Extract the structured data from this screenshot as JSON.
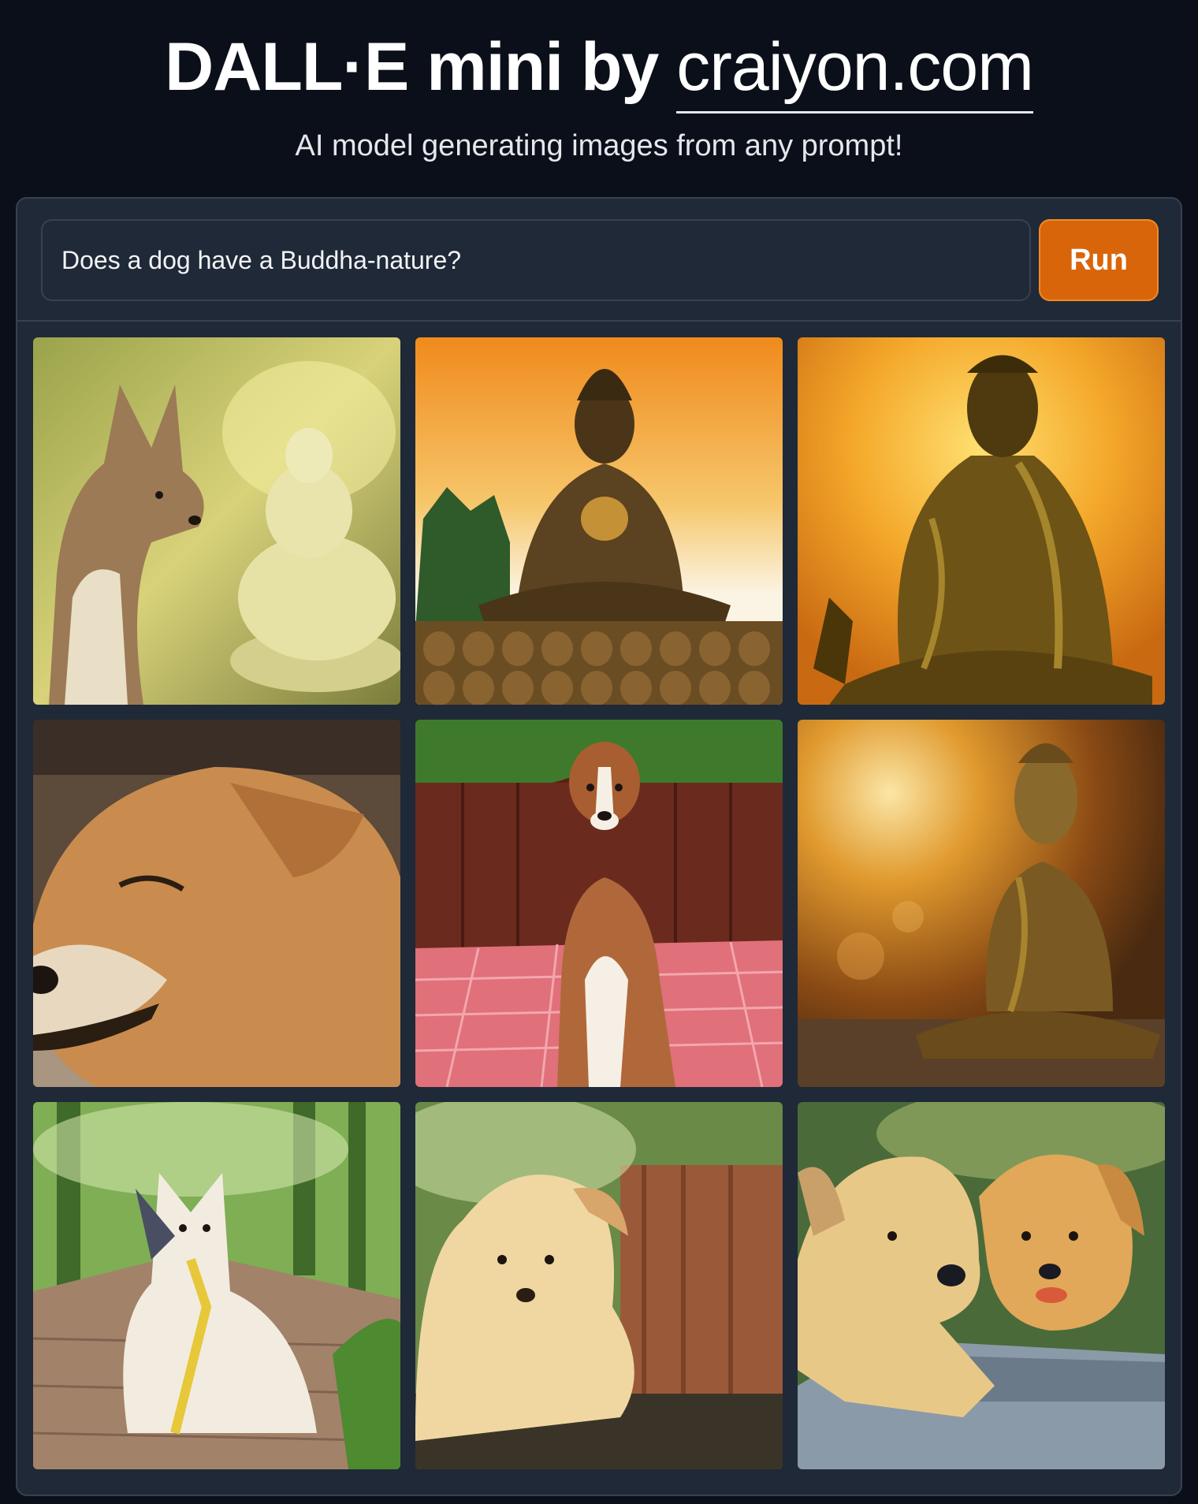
{
  "header": {
    "title": "DALL·E mini by",
    "site": "craiyon.com",
    "subtitle": "AI model generating images from any prompt!"
  },
  "prompt": {
    "value": "Does a dog have a Buddha-nature?",
    "run_label": "Run"
  },
  "gallery": {
    "images": [
      {
        "subject": "dog beside white buddha statue"
      },
      {
        "subject": "bronze buddha statue with many small statues"
      },
      {
        "subject": "golden buddha statue"
      },
      {
        "subject": "shiba dog close-up"
      },
      {
        "subject": "brown and white dog sitting on red tiles"
      },
      {
        "subject": "golden buddha statue with bokeh"
      },
      {
        "subject": "white dog sitting on wooden path"
      },
      {
        "subject": "fluffy puppy"
      },
      {
        "subject": "two golden dogs on stone"
      }
    ]
  },
  "colors": {
    "background": "#0b0f19",
    "panel": "#1f2937",
    "border": "#374151",
    "run_button": "#d9650b"
  }
}
